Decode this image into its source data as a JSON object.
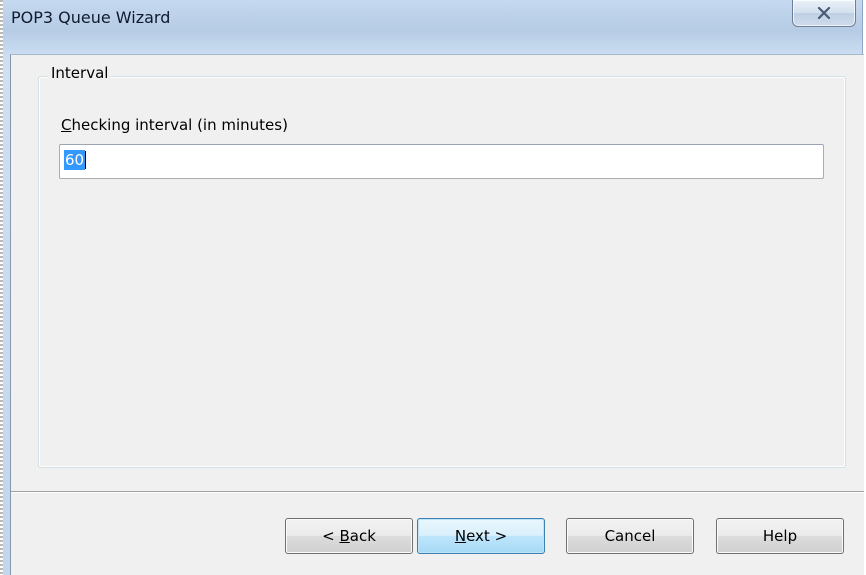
{
  "window": {
    "title": "POP3 Queue Wizard",
    "close_icon": "close-icon"
  },
  "group": {
    "legend": "Interval"
  },
  "field": {
    "label_prefix": "C",
    "label_rest": "hecking interval (in minutes)",
    "value": "60"
  },
  "buttons": {
    "back_prefix": "< ",
    "back_mnemonic": "B",
    "back_rest": "ack",
    "next_mnemonic": "N",
    "next_rest": "ext >",
    "cancel": "Cancel",
    "help": "Help"
  },
  "colors": {
    "selection": "#3399ff",
    "default_button_border": "#3c7fb1"
  }
}
